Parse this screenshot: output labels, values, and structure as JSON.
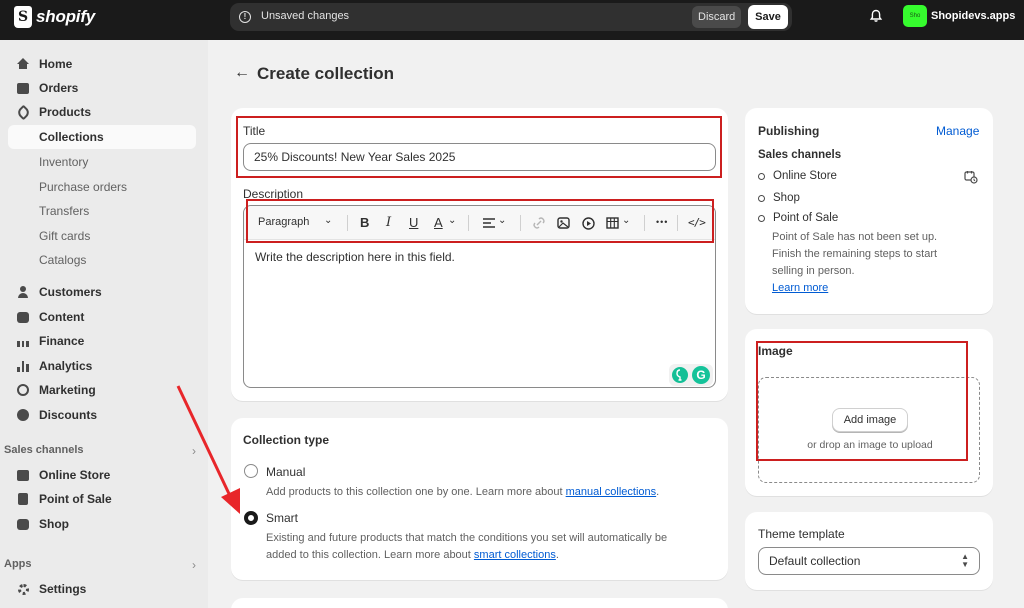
{
  "topbar": {
    "brand": "shopify",
    "unsaved_message": "Unsaved changes",
    "discard_label": "Discard",
    "save_label": "Save",
    "store_avatar_text": "Sho",
    "store_name": "Shopidevs.apps"
  },
  "sidebar": {
    "items": [
      {
        "label": "Home",
        "icon": "home-icon"
      },
      {
        "label": "Orders",
        "icon": "inbox-icon"
      },
      {
        "label": "Products",
        "icon": "tag-icon"
      },
      {
        "label": "Collections"
      },
      {
        "label": "Inventory"
      },
      {
        "label": "Purchase orders"
      },
      {
        "label": "Transfers"
      },
      {
        "label": "Gift cards"
      },
      {
        "label": "Catalogs"
      },
      {
        "label": "Customers",
        "icon": "person-icon"
      },
      {
        "label": "Content",
        "icon": "content-icon"
      },
      {
        "label": "Finance",
        "icon": "bank-icon"
      },
      {
        "label": "Analytics",
        "icon": "bar-chart-icon"
      },
      {
        "label": "Marketing",
        "icon": "target-icon"
      },
      {
        "label": "Discounts",
        "icon": "discount-icon"
      }
    ],
    "sales_channels_header": "Sales channels",
    "sales_channels": [
      {
        "label": "Online Store",
        "icon": "storefront-icon"
      },
      {
        "label": "Point of Sale",
        "icon": "pos-icon"
      },
      {
        "label": "Shop",
        "icon": "shop-bag-icon"
      }
    ],
    "apps_header": "Apps",
    "settings_label": "Settings"
  },
  "page": {
    "title": "Create collection"
  },
  "title_field": {
    "label": "Title",
    "value": "25% Discounts! New Year Sales 2025"
  },
  "description": {
    "label": "Description",
    "toolbar": {
      "paragraph_label": "Paragraph",
      "bold": "B",
      "italic": "I",
      "underline": "U",
      "text_color": "A",
      "more": "•••",
      "code": "</>"
    },
    "body": "Write the description here in this field."
  },
  "collection_type": {
    "heading": "Collection type",
    "manual_label": "Manual",
    "manual_help": "Add products to this collection one by one. Learn more about ",
    "manual_link": "manual collections",
    "manual_after": ".",
    "smart_label": "Smart",
    "smart_help_1": "Existing and future products that match the conditions you set will automatically be",
    "smart_help_2": "added to this collection. Learn more about ",
    "smart_link": "smart collections",
    "smart_after": ".",
    "selected": "Smart"
  },
  "publishing": {
    "heading": "Publishing",
    "manage_label": "Manage",
    "sales_channels_label": "Sales channels",
    "channels": [
      "Online Store",
      "Shop",
      "Point of Sale"
    ],
    "pos_note_1": "Point of Sale has not been set up.",
    "pos_note_2": "Finish the remaining steps to start",
    "pos_note_3": "selling in person.",
    "learn_more": "Learn more"
  },
  "image": {
    "heading": "Image",
    "add_button": "Add image",
    "drop_hint": "or drop an image to upload"
  },
  "theme_template": {
    "label": "Theme template",
    "value": "Default collection"
  },
  "colors": {
    "topbar_bg": "#1a1a1a",
    "highlight_red": "#cc1f1f",
    "annotation_arrow": "#e8262a",
    "link_blue": "#005bd3",
    "store_avatar": "#36fc2e"
  }
}
